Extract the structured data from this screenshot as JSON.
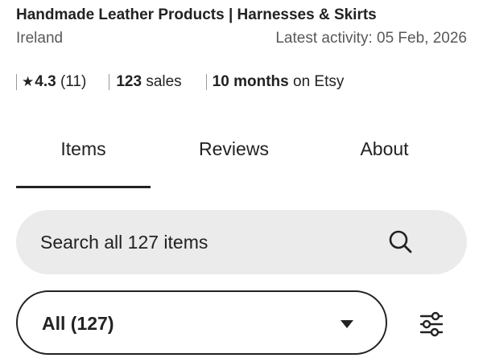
{
  "shop": {
    "title": "Handmade Leather Products | Harnesses & Skirts",
    "location": "Ireland",
    "latest_activity": "Latest activity: 05 Feb, 2026"
  },
  "stats": {
    "star_glyph": "★",
    "rating": "4.3",
    "review_count": "(11)",
    "sales_count": "123",
    "sales_label": "sales",
    "tenure": "10 months",
    "tenure_suffix": "on Etsy"
  },
  "tabs": [
    {
      "label": "Items",
      "active": true
    },
    {
      "label": "Reviews",
      "active": false
    },
    {
      "label": "About",
      "active": false
    }
  ],
  "search": {
    "placeholder": "Search all 127 items",
    "icon": "search-icon"
  },
  "filter": {
    "selected": "All (127)",
    "caret_icon": "caret-down-icon",
    "filter_icon": "sliders-icon"
  },
  "colors": {
    "text": "#222222",
    "muted": "#595959",
    "search_bg": "#ebebeb"
  }
}
